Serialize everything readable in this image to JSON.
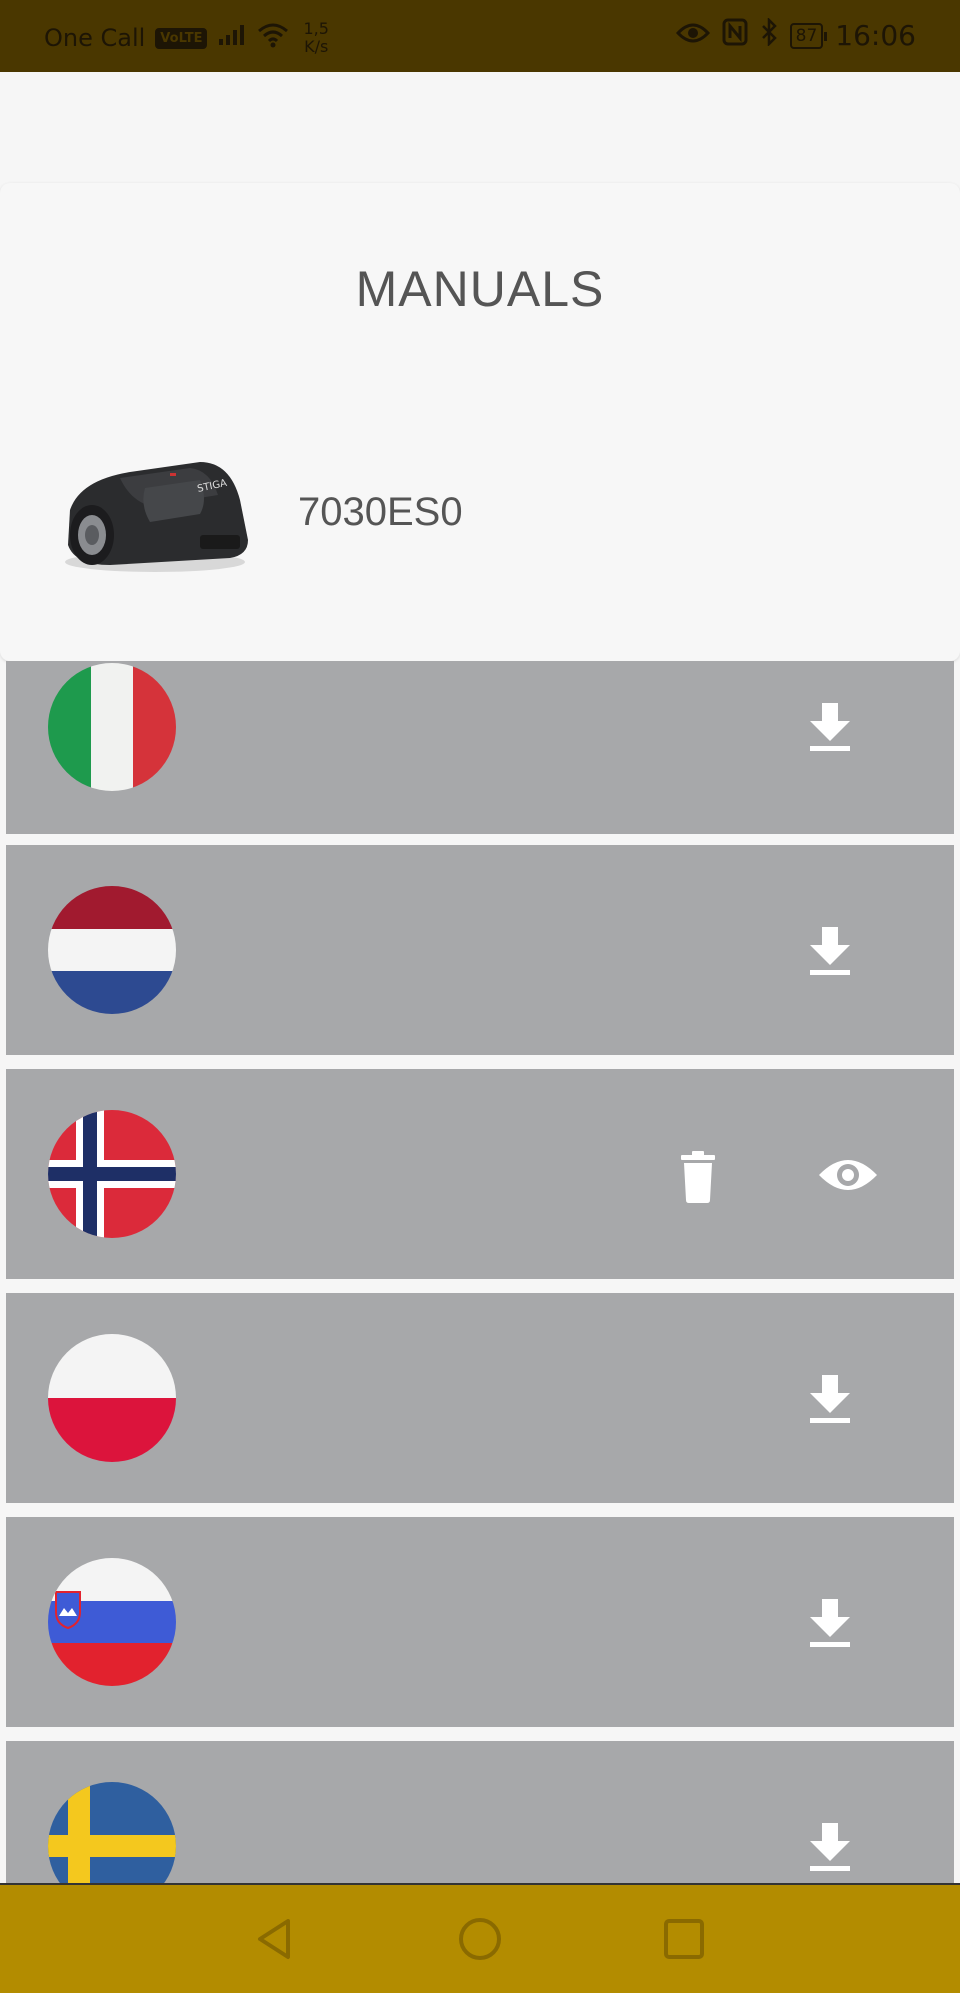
{
  "status_bar": {
    "carrier": "One Call",
    "volte": "VoLTE",
    "speed_value": "1,5",
    "speed_unit": "K/s",
    "battery": "87",
    "time": "16:06",
    "icons": [
      "signal-icon",
      "wifi-icon",
      "eye-icon",
      "nfc-icon",
      "bluetooth-icon",
      "battery-icon"
    ]
  },
  "header": {
    "title": "MANUALS",
    "model": "7030ES0",
    "product_image": "robotic-lawnmower-image"
  },
  "manuals": [
    {
      "flag": "italy-flag-icon",
      "action": "download"
    },
    {
      "flag": "netherlands-flag-icon",
      "action": "download"
    },
    {
      "flag": "norway-flag-icon",
      "action": "downloaded",
      "secondary_action": "delete"
    },
    {
      "flag": "poland-flag-icon",
      "action": "download"
    },
    {
      "flag": "slovenia-flag-icon",
      "action": "download"
    },
    {
      "flag": "sweden-flag-icon",
      "action": "download"
    }
  ],
  "colors": {
    "status_bar_bg": "#4a3700",
    "row_bg": "#a7a8aa",
    "nav_bar_bg": "#b38c00",
    "icon_color": "#ffffff"
  },
  "nav_bar": {
    "buttons": [
      "back-icon",
      "home-icon",
      "recents-icon"
    ]
  }
}
